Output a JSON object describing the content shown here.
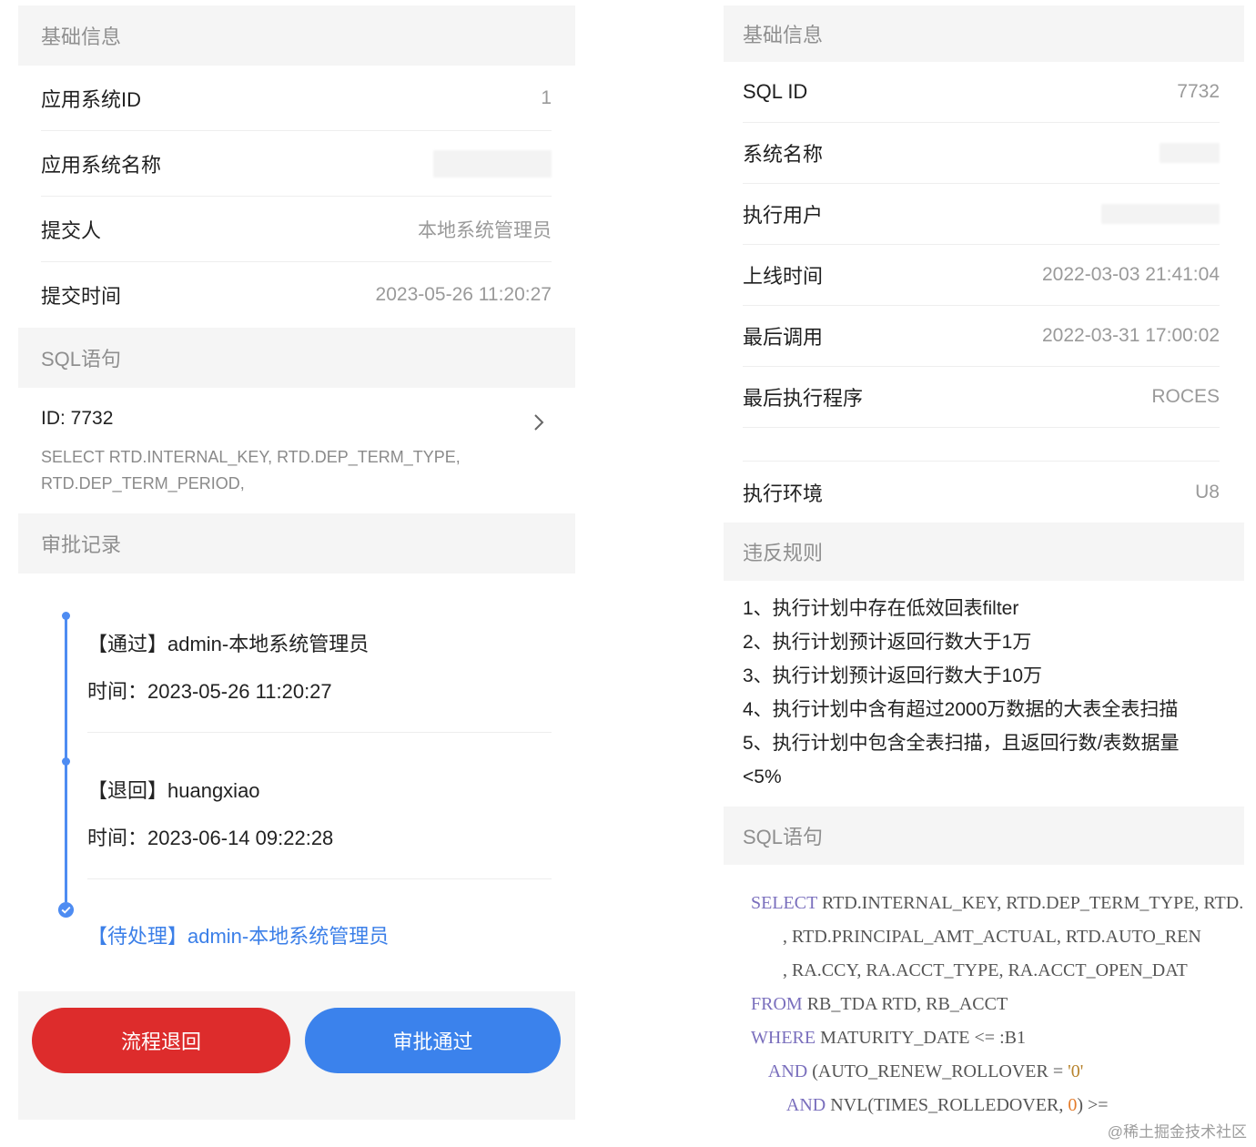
{
  "left": {
    "basic_header": "基础信息",
    "rows": [
      {
        "label": "应用系统ID",
        "value": "1"
      },
      {
        "label": "应用系统名称",
        "value": ""
      },
      {
        "label": "提交人",
        "value": "本地系统管理员"
      },
      {
        "label": "提交时间",
        "value": "2023-05-26 11:20:27"
      }
    ],
    "sql_header": "SQL语句",
    "sql_id": "ID: 7732",
    "sql_preview": "SELECT RTD.INTERNAL_KEY, RTD.DEP_TERM_TYPE, RTD.DEP_TERM_PERIOD,",
    "approval_header": "审批记录",
    "timeline": [
      {
        "title": "【通过】admin-本地系统管理员",
        "time": "时间：2023-05-26 11:20:27"
      },
      {
        "title": "【退回】huangxiao",
        "time": "时间：2023-06-14 09:22:28"
      },
      {
        "title": "【待处理】admin-本地系统管理员"
      }
    ],
    "buttons": {
      "return": "流程退回",
      "approve": "审批通过"
    }
  },
  "right": {
    "basic_header": "基础信息",
    "rows": [
      {
        "label": "SQL ID",
        "value": "7732"
      },
      {
        "label": "系统名称",
        "value": ""
      },
      {
        "label": "执行用户",
        "value": ""
      },
      {
        "label": "上线时间",
        "value": "2022-03-03 21:41:04"
      },
      {
        "label": "最后调用",
        "value": "2022-03-31 17:00:02"
      },
      {
        "label": "最后执行程序",
        "value": "ROCES"
      },
      {
        "label": "执行环境",
        "value": "U8"
      }
    ],
    "rules_header": "违反规则",
    "rules": [
      "1、执行计划中存在低效回表filter",
      "2、执行计划预计返回行数大于1万",
      "3、执行计划预计返回行数大于10万",
      "4、执行计划中含有超过2000万数据的大表全表扫描",
      "5、执行计划中包含全表扫描，且返回行数/表数据量",
      "<5%"
    ],
    "sql_header": "SQL语句",
    "sql_lines": [
      {
        "kw": "SELECT",
        "text": " RTD.INTERNAL_KEY, RTD.DEP_TERM_TYPE, RTD."
      },
      {
        "kw": "",
        "text": "       , RTD.PRINCIPAL_AMT_ACTUAL, RTD.AUTO_REN"
      },
      {
        "kw": "",
        "text": "       , RA.CCY, RA.ACCT_TYPE, RA.ACCT_OPEN_DAT"
      },
      {
        "kw": "FROM",
        "text": " RB_TDA RTD, RB_ACCT"
      },
      {
        "kw": "WHERE",
        "text": " MATURITY_DATE <= :B1"
      },
      {
        "kw": "AND",
        "text": " (AUTO_RENEW_ROLLOVER = ",
        "str": "'0'"
      },
      {
        "kw": "AND",
        "text": " NVL(TIMES_ROLLEDOVER, ",
        "num": "0",
        "tail": ") >="
      }
    ],
    "watermark": "@稀土掘金技术社区"
  },
  "colors": {
    "accent_blue": "#3b82ec",
    "danger_red": "#dd2c2c",
    "timeline_blue": "#4e8cf2"
  }
}
